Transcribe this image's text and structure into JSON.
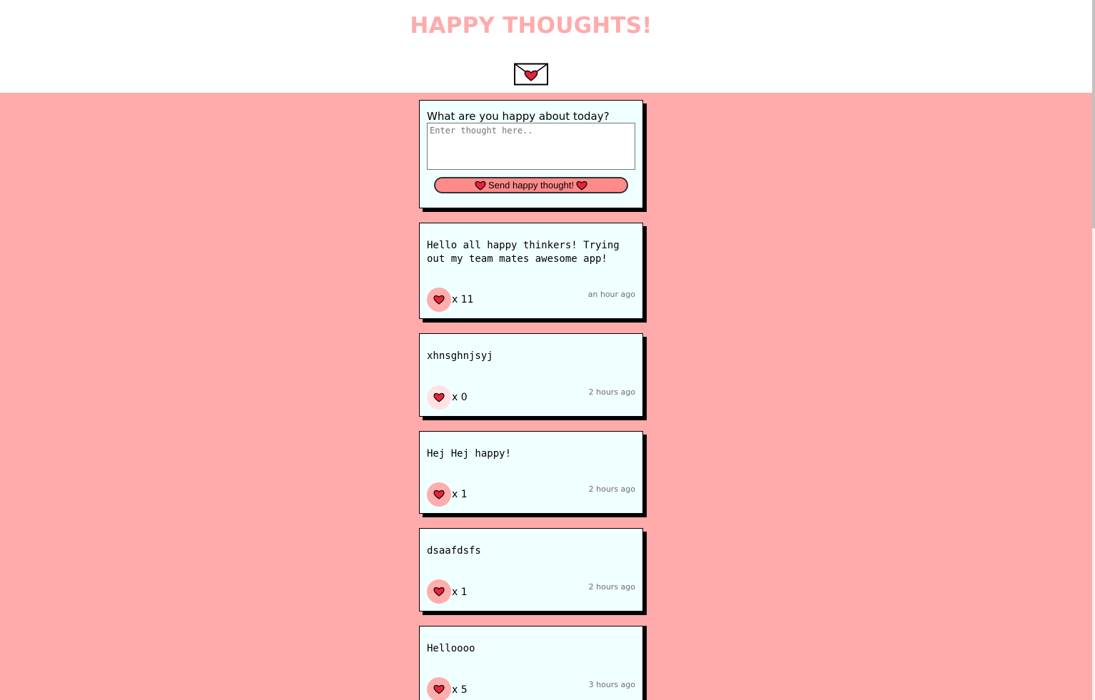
{
  "header": {
    "title": "HAPPY THOUGHTS!",
    "logo_icon": "envelope-heart-icon",
    "accent_color": "#ffabab"
  },
  "form": {
    "question": "What are you happy about today?",
    "placeholder": "Enter thought here..",
    "value": "",
    "submit_label": "Send happy thought!",
    "submit_icon": "heart-icon"
  },
  "thoughts": [
    {
      "text": "Hello all happy thinkers! Trying out my team mates awesome app!",
      "likes_label": "x 11",
      "time": "an hour ago"
    },
    {
      "text": "xhnsghnjsyj",
      "likes_label": "x 0",
      "time": "2 hours ago"
    },
    {
      "text": "Hej Hej happy!",
      "likes_label": "x 1",
      "time": "2 hours ago"
    },
    {
      "text": "dsaafdsfs",
      "likes_label": "x 1",
      "time": "2 hours ago"
    },
    {
      "text": "Helloooo",
      "likes_label": "x 5",
      "time": "3 hours ago"
    }
  ],
  "colors": {
    "background": "#ffabab",
    "card": "#f0ffff",
    "like_active": "#ffadad",
    "like_inactive": "#ffe3e3",
    "heart": "#e8233a"
  }
}
